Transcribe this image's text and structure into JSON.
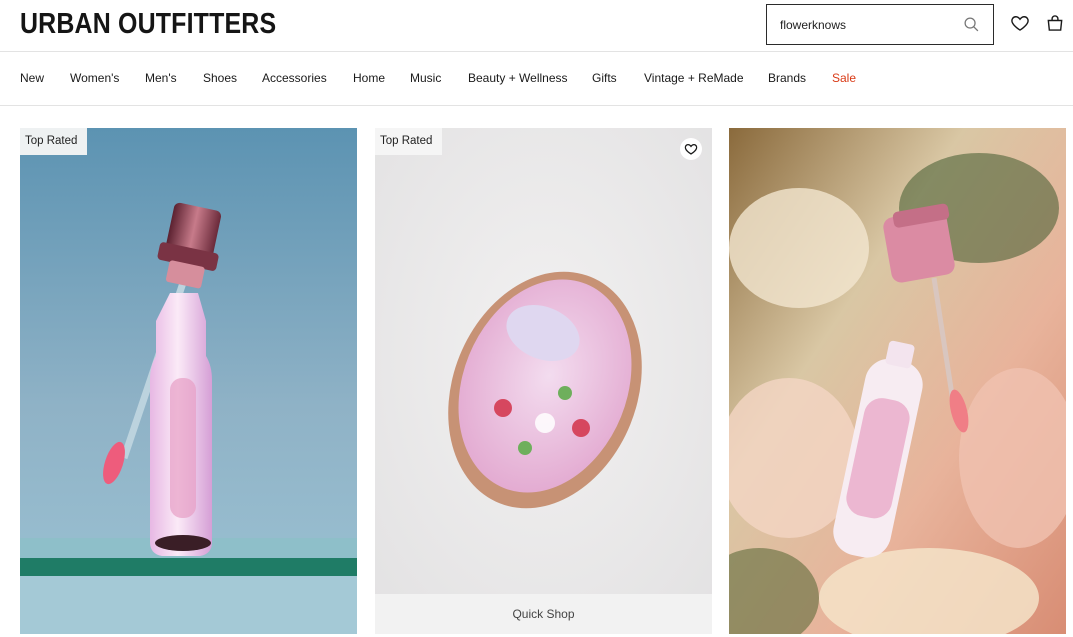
{
  "brand": {
    "logo_text": "URBAN OUTFITTERS"
  },
  "search": {
    "value": "flowerknows",
    "icon": "search-icon"
  },
  "header_icons": {
    "wishlist": "heart-icon",
    "bag": "shopping-bag-icon"
  },
  "nav": {
    "items": [
      {
        "label": "New"
      },
      {
        "label": "Women's"
      },
      {
        "label": "Men's"
      },
      {
        "label": "Shoes"
      },
      {
        "label": "Accessories"
      },
      {
        "label": "Home"
      },
      {
        "label": "Music"
      },
      {
        "label": "Beauty + Wellness"
      },
      {
        "label": "Gifts"
      },
      {
        "label": "Vintage + ReMade"
      },
      {
        "label": "Brands"
      },
      {
        "label": "Sale"
      }
    ],
    "sale_color": "#d93a16"
  },
  "products": [
    {
      "badge": "Top Rated",
      "image": "lip-gloss-photo"
    },
    {
      "badge": "Top Rated",
      "image": "compact-mirror-photo",
      "quick_shop_label": "Quick Shop",
      "favorite_icon": "heart-icon"
    },
    {
      "image": "lotion-bottle-floral-photo"
    }
  ]
}
